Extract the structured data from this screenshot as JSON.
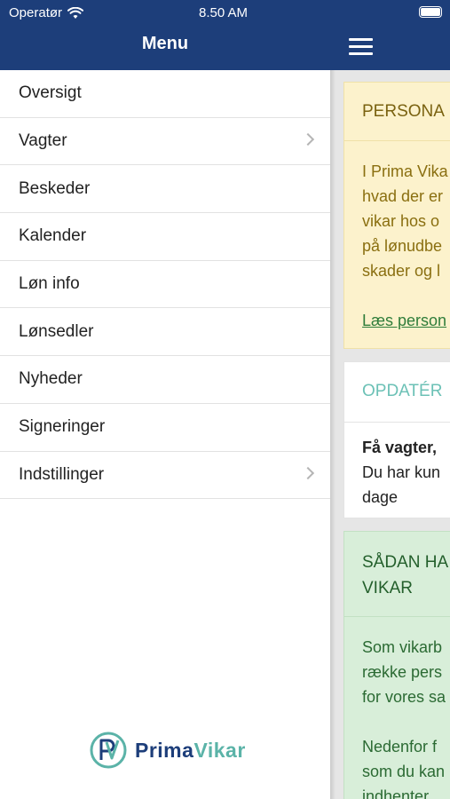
{
  "status_bar": {
    "carrier": "Operatør",
    "time": "8.50 AM"
  },
  "header": {
    "menu_title": "Menu"
  },
  "menu": {
    "items": [
      {
        "label": "Oversigt",
        "has_chevron": false
      },
      {
        "label": "Vagter",
        "has_chevron": true
      },
      {
        "label": "Beskeder",
        "has_chevron": false
      },
      {
        "label": "Kalender",
        "has_chevron": false
      },
      {
        "label": "Løn info",
        "has_chevron": false
      },
      {
        "label": "Lønsedler",
        "has_chevron": false
      },
      {
        "label": "Nyheder",
        "has_chevron": false
      },
      {
        "label": "Signeringer",
        "has_chevron": false
      },
      {
        "label": "Indstillinger",
        "has_chevron": true
      }
    ]
  },
  "logo": {
    "part1": "Prima",
    "part2": "Vikar"
  },
  "content": {
    "card1": {
      "title": "PERSONA",
      "lines": [
        "I Prima Vika",
        "hvad der er",
        "vikar hos o",
        "på lønudbe",
        "skader og l"
      ],
      "link": "Læs person"
    },
    "card2": {
      "title": "OPDATÉR",
      "line_bold": "Få vagter,",
      "lines": [
        "Du har kun",
        "dage"
      ]
    },
    "card3": {
      "title": "SÅDAN HA VIKAR",
      "lines": [
        "Som vikarb",
        "række pers",
        "for vores sa"
      ],
      "lines2": [
        "Nedenfor f",
        "som du kan",
        "indhenter"
      ]
    }
  },
  "colors": {
    "header_bg": "#1d3e7a",
    "logo_teal": "#5bb3a8",
    "yellow_card": "#fcf2cc",
    "green_card": "#d8eed9"
  }
}
